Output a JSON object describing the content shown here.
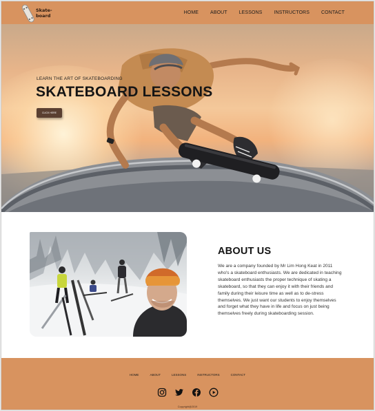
{
  "header": {
    "logo_line1": "Skate-",
    "logo_line2": "board",
    "nav": [
      "HOME",
      "ABOUT",
      "LESSONS",
      "INSTRUCTORS",
      "CONTACT"
    ]
  },
  "hero": {
    "tagline": "LEARN THE ART OF SKATEBOARDING",
    "title": "SKATEBOARD LESSONS",
    "button_label": "CLICK HERE"
  },
  "about": {
    "title": "ABOUT US",
    "text": "We are a company founded by Mr Lim Hong Keat in 2011 who's a skateboard enthusiasts. We are dedicated in teaching skateboard enthusiasts the proper technique of skating a skateboard, so that they can enjoy it with their friends and family during their leisure time as well as to de-stress themselves. We just want our students to enjoy themselves and forget what they have in life and focus on just being themselves freely during skateboarding session."
  },
  "footer": {
    "nav": [
      "HOME",
      "ABOUT",
      "LESSONS",
      "INSTRUCTORS",
      "CONTACT"
    ],
    "social_icons": [
      "instagram-icon",
      "twitter-icon",
      "facebook-icon",
      "youtube-icon"
    ],
    "copyright": "Copyright@2019"
  },
  "colors": {
    "accent": "#d8935f",
    "button": "#5a3f31",
    "text_dark": "#151515"
  }
}
